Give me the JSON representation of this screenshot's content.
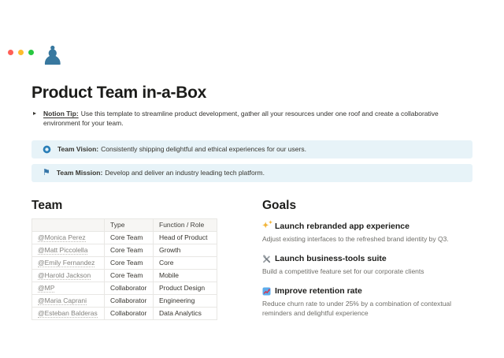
{
  "window": {
    "traffic_lights": [
      "close",
      "minimize",
      "zoom"
    ]
  },
  "icons": {
    "page_icon": {
      "name": "pawn-icon",
      "glyph": "♟",
      "color": "#38789f"
    },
    "toggle": {
      "name": "toggle-triangle-icon",
      "glyph": "▸"
    },
    "vision": {
      "name": "blue-ring-icon",
      "color": "#2a7fb8"
    },
    "mission": {
      "name": "blue-flag-icon",
      "glyph": "⚑",
      "color": "#3676a8"
    },
    "goal_sparkles": {
      "name": "sparkles-icon",
      "emoji": "✨",
      "glyph": "✦",
      "color": "#f2b53a"
    },
    "goal_tools": {
      "name": "hammer-and-wrench-icon",
      "emoji": "🛠️",
      "color": "#8e9499"
    },
    "goal_chart": {
      "name": "chart-increasing-icon",
      "emoji": "📈",
      "colors": [
        "#5dadec",
        "#dd2e44"
      ]
    }
  },
  "page": {
    "title": "Product Team in-a-Box",
    "tip": {
      "label": "Notion Tip:",
      "text": "Use this template to streamline product development, gather all your resources under one roof and create a collaborative environment for your team."
    },
    "callouts": [
      {
        "label": "Team Vision:",
        "text": "Consistently shipping delightful and ethical experiences for our users."
      },
      {
        "label": "Team Mission:",
        "text": "Develop and deliver an industry leading tech platform."
      }
    ],
    "team": {
      "heading": "Team",
      "table": {
        "headers": [
          "",
          "Type",
          "Function / Role"
        ],
        "rows": [
          [
            "@Monica Perez",
            "Core Team",
            "Head of Product"
          ],
          [
            "@Matt Piccolella",
            "Core Team",
            "Growth"
          ],
          [
            "@Emily Fernandez",
            "Core Team",
            "Core"
          ],
          [
            "@Harold Jackson",
            "Core Team",
            "Mobile"
          ],
          [
            "@MP",
            "Collaborator",
            "Product Design"
          ],
          [
            "@Maria Caprani",
            "Collaborator",
            "Engineering"
          ],
          [
            "@Esteban Balderas",
            "Collaborator",
            "Data Analytics"
          ]
        ]
      }
    },
    "goals": {
      "heading": "Goals",
      "items": [
        {
          "title": "Launch rebranded app experience",
          "description": "Adjust existing interfaces to the refreshed brand identity by Q3."
        },
        {
          "title": "Launch business-tools suite",
          "description": "Build a competitive feature set for our corporate clients"
        },
        {
          "title": "Improve retention rate",
          "description": "Reduce churn rate to under 25% by a combination of contextual reminders and delightful experience"
        }
      ]
    }
  },
  "colors": {
    "callout_bg": "#e7f3f8",
    "table_border": "#e8e7e4",
    "table_header_bg": "#f7f6f4",
    "text_primary": "#37352f",
    "text_muted": "#6f6e69",
    "traffic_red": "#ff5f57",
    "traffic_yellow": "#febc2e",
    "traffic_green": "#28c840"
  }
}
